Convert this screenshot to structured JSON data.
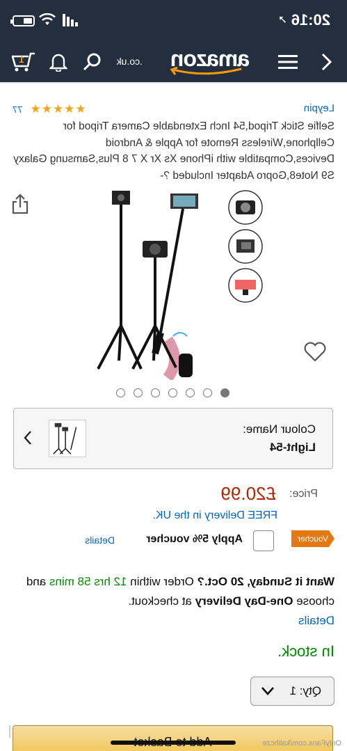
{
  "status_bar": {
    "time": "20:16"
  },
  "navbar": {
    "logo_text": "amazon",
    "logo_tld": ".co.uk",
    "back_icon": "chevron-left-icon",
    "menu_icon": "menu-icon",
    "search_icon": "search-icon",
    "notification_icon": "bell-icon",
    "cart_icon": "cart-icon",
    "cart_count": "1"
  },
  "product": {
    "brand": "Leypin",
    "rating_stars": "★★★★★",
    "rating_count": "77",
    "title": "Selfie Stick Tripod,54 Inch Extendable Camera Tripod for Cellphone,Wireless Remote for Apple & Android Devices,Compatible with iPhone Xs Xr X 7 8 Plus,Samsung Galaxy S9 Note8,Gopro Adapter Included ?-",
    "image_count": 7,
    "active_image_index": 0
  },
  "variation": {
    "label": "Colour Name:",
    "value": "Light-54"
  },
  "pricing": {
    "price_label": "Price:",
    "price": "£20.99",
    "free_delivery": "FREE Delivery in the UK."
  },
  "voucher": {
    "badge": "Voucher",
    "text": "Apply 5% voucher",
    "details": "Details"
  },
  "delivery": {
    "want_it": "Want it Sunday, 20 Oct.?",
    "order_within": " Order within ",
    "countdown": "12 hrs 58 mins",
    "choose": " and choose ",
    "option": "One-Day Delivery",
    "at_checkout": " at checkout.",
    "details": "Details"
  },
  "availability": {
    "text": "In stock."
  },
  "quantity": {
    "label": "Qty:",
    "value": "1"
  },
  "cart_button": {
    "label": "Add to Basket"
  },
  "watermark": "OnlyFans.com/kalihcze",
  "colors": {
    "nav_bg": "#232f3e",
    "link": "#0066c0",
    "price": "#b12704",
    "stock": "#008a00",
    "star": "#f4a41a",
    "voucher": "#e47911"
  }
}
